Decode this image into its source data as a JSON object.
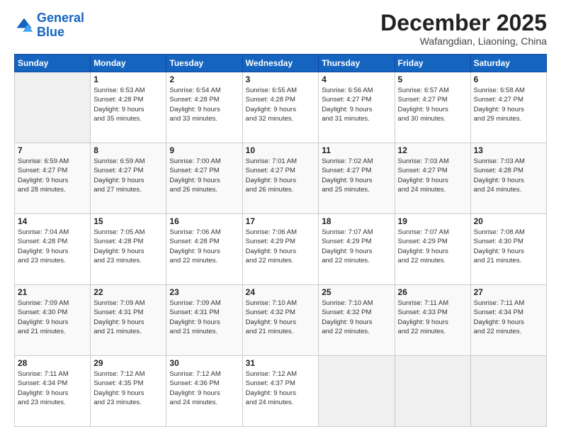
{
  "logo": {
    "line1": "General",
    "line2": "Blue"
  },
  "header": {
    "month": "December 2025",
    "location": "Wafangdian, Liaoning, China"
  },
  "weekdays": [
    "Sunday",
    "Monday",
    "Tuesday",
    "Wednesday",
    "Thursday",
    "Friday",
    "Saturday"
  ],
  "weeks": [
    [
      {
        "day": "",
        "sunrise": "",
        "sunset": "",
        "daylight": ""
      },
      {
        "day": "1",
        "sunrise": "Sunrise: 6:53 AM",
        "sunset": "Sunset: 4:28 PM",
        "daylight": "Daylight: 9 hours and 35 minutes."
      },
      {
        "day": "2",
        "sunrise": "Sunrise: 6:54 AM",
        "sunset": "Sunset: 4:28 PM",
        "daylight": "Daylight: 9 hours and 33 minutes."
      },
      {
        "day": "3",
        "sunrise": "Sunrise: 6:55 AM",
        "sunset": "Sunset: 4:28 PM",
        "daylight": "Daylight: 9 hours and 32 minutes."
      },
      {
        "day": "4",
        "sunrise": "Sunrise: 6:56 AM",
        "sunset": "Sunset: 4:27 PM",
        "daylight": "Daylight: 9 hours and 31 minutes."
      },
      {
        "day": "5",
        "sunrise": "Sunrise: 6:57 AM",
        "sunset": "Sunset: 4:27 PM",
        "daylight": "Daylight: 9 hours and 30 minutes."
      },
      {
        "day": "6",
        "sunrise": "Sunrise: 6:58 AM",
        "sunset": "Sunset: 4:27 PM",
        "daylight": "Daylight: 9 hours and 29 minutes."
      }
    ],
    [
      {
        "day": "7",
        "sunrise": "Sunrise: 6:59 AM",
        "sunset": "Sunset: 4:27 PM",
        "daylight": "Daylight: 9 hours and 28 minutes."
      },
      {
        "day": "8",
        "sunrise": "Sunrise: 6:59 AM",
        "sunset": "Sunset: 4:27 PM",
        "daylight": "Daylight: 9 hours and 27 minutes."
      },
      {
        "day": "9",
        "sunrise": "Sunrise: 7:00 AM",
        "sunset": "Sunset: 4:27 PM",
        "daylight": "Daylight: 9 hours and 26 minutes."
      },
      {
        "day": "10",
        "sunrise": "Sunrise: 7:01 AM",
        "sunset": "Sunset: 4:27 PM",
        "daylight": "Daylight: 9 hours and 26 minutes."
      },
      {
        "day": "11",
        "sunrise": "Sunrise: 7:02 AM",
        "sunset": "Sunset: 4:27 PM",
        "daylight": "Daylight: 9 hours and 25 minutes."
      },
      {
        "day": "12",
        "sunrise": "Sunrise: 7:03 AM",
        "sunset": "Sunset: 4:27 PM",
        "daylight": "Daylight: 9 hours and 24 minutes."
      },
      {
        "day": "13",
        "sunrise": "Sunrise: 7:03 AM",
        "sunset": "Sunset: 4:28 PM",
        "daylight": "Daylight: 9 hours and 24 minutes."
      }
    ],
    [
      {
        "day": "14",
        "sunrise": "Sunrise: 7:04 AM",
        "sunset": "Sunset: 4:28 PM",
        "daylight": "Daylight: 9 hours and 23 minutes."
      },
      {
        "day": "15",
        "sunrise": "Sunrise: 7:05 AM",
        "sunset": "Sunset: 4:28 PM",
        "daylight": "Daylight: 9 hours and 23 minutes."
      },
      {
        "day": "16",
        "sunrise": "Sunrise: 7:06 AM",
        "sunset": "Sunset: 4:28 PM",
        "daylight": "Daylight: 9 hours and 22 minutes."
      },
      {
        "day": "17",
        "sunrise": "Sunrise: 7:06 AM",
        "sunset": "Sunset: 4:29 PM",
        "daylight": "Daylight: 9 hours and 22 minutes."
      },
      {
        "day": "18",
        "sunrise": "Sunrise: 7:07 AM",
        "sunset": "Sunset: 4:29 PM",
        "daylight": "Daylight: 9 hours and 22 minutes."
      },
      {
        "day": "19",
        "sunrise": "Sunrise: 7:07 AM",
        "sunset": "Sunset: 4:29 PM",
        "daylight": "Daylight: 9 hours and 22 minutes."
      },
      {
        "day": "20",
        "sunrise": "Sunrise: 7:08 AM",
        "sunset": "Sunset: 4:30 PM",
        "daylight": "Daylight: 9 hours and 21 minutes."
      }
    ],
    [
      {
        "day": "21",
        "sunrise": "Sunrise: 7:09 AM",
        "sunset": "Sunset: 4:30 PM",
        "daylight": "Daylight: 9 hours and 21 minutes."
      },
      {
        "day": "22",
        "sunrise": "Sunrise: 7:09 AM",
        "sunset": "Sunset: 4:31 PM",
        "daylight": "Daylight: 9 hours and 21 minutes."
      },
      {
        "day": "23",
        "sunrise": "Sunrise: 7:09 AM",
        "sunset": "Sunset: 4:31 PM",
        "daylight": "Daylight: 9 hours and 21 minutes."
      },
      {
        "day": "24",
        "sunrise": "Sunrise: 7:10 AM",
        "sunset": "Sunset: 4:32 PM",
        "daylight": "Daylight: 9 hours and 21 minutes."
      },
      {
        "day": "25",
        "sunrise": "Sunrise: 7:10 AM",
        "sunset": "Sunset: 4:32 PM",
        "daylight": "Daylight: 9 hours and 22 minutes."
      },
      {
        "day": "26",
        "sunrise": "Sunrise: 7:11 AM",
        "sunset": "Sunset: 4:33 PM",
        "daylight": "Daylight: 9 hours and 22 minutes."
      },
      {
        "day": "27",
        "sunrise": "Sunrise: 7:11 AM",
        "sunset": "Sunset: 4:34 PM",
        "daylight": "Daylight: 9 hours and 22 minutes."
      }
    ],
    [
      {
        "day": "28",
        "sunrise": "Sunrise: 7:11 AM",
        "sunset": "Sunset: 4:34 PM",
        "daylight": "Daylight: 9 hours and 23 minutes."
      },
      {
        "day": "29",
        "sunrise": "Sunrise: 7:12 AM",
        "sunset": "Sunset: 4:35 PM",
        "daylight": "Daylight: 9 hours and 23 minutes."
      },
      {
        "day": "30",
        "sunrise": "Sunrise: 7:12 AM",
        "sunset": "Sunset: 4:36 PM",
        "daylight": "Daylight: 9 hours and 24 minutes."
      },
      {
        "day": "31",
        "sunrise": "Sunrise: 7:12 AM",
        "sunset": "Sunset: 4:37 PM",
        "daylight": "Daylight: 9 hours and 24 minutes."
      },
      {
        "day": "",
        "sunrise": "",
        "sunset": "",
        "daylight": ""
      },
      {
        "day": "",
        "sunrise": "",
        "sunset": "",
        "daylight": ""
      },
      {
        "day": "",
        "sunrise": "",
        "sunset": "",
        "daylight": ""
      }
    ]
  ]
}
